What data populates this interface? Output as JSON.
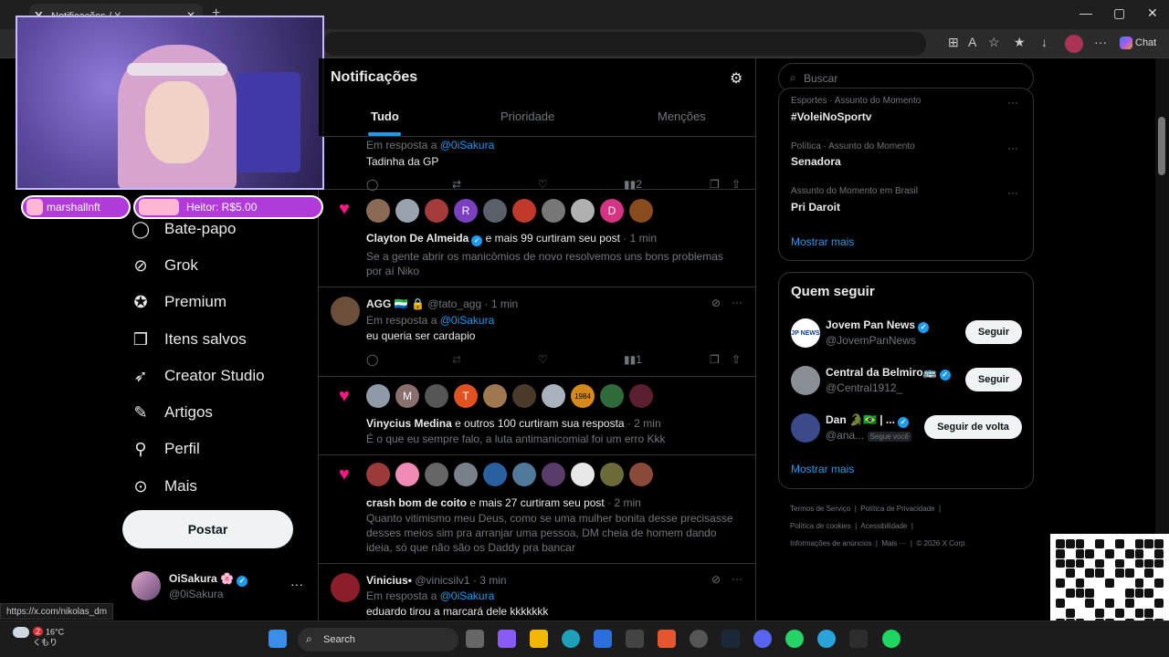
{
  "browser": {
    "tab_title": "Notificações / X",
    "tab_logo": "X",
    "close_glyph": "✕",
    "new_tab_glyph": "+",
    "window_controls": [
      "—",
      "▢",
      "✕"
    ],
    "chat_label": "Chat",
    "status_url": "https://x.com/nikolas_dm"
  },
  "nav": {
    "items": [
      {
        "label": "Bate-papo",
        "icon": "chat-icon"
      },
      {
        "label": "Grok",
        "icon": "grok-icon"
      },
      {
        "label": "Premium",
        "icon": "premium-icon"
      },
      {
        "label": "Itens salvos",
        "icon": "bookmark-icon"
      },
      {
        "label": "Creator Studio",
        "icon": "rocket-icon"
      },
      {
        "label": "Artigos",
        "icon": "article-icon"
      },
      {
        "label": "Perfil",
        "icon": "person-icon"
      },
      {
        "label": "Mais",
        "icon": "more-circle-icon"
      }
    ],
    "post_label": "Postar",
    "profile": {
      "name": "OiSakura 🌸",
      "handle": "@0iSakura",
      "more": "···"
    }
  },
  "main": {
    "title": "Notificações",
    "tabs": [
      {
        "label": "Tudo",
        "active": true
      },
      {
        "label": "Prioridade",
        "active": false
      },
      {
        "label": "Menções",
        "active": false
      }
    ],
    "n1": {
      "reply_to_prefix": "Em resposta a",
      "reply_to_handle": "@0iSakura",
      "text": "Tadinha da GP",
      "views": "2"
    },
    "n2": {
      "avatars": [
        "",
        "",
        "",
        "R",
        "",
        "",
        "",
        "",
        "D",
        ""
      ],
      "name": "Clayton De Almeida",
      "action": "e mais 99 curtiram seu post",
      "time": "· 1 min",
      "text_line1": "Se a gente abrir os manicômios de novo resolvemos uns bons problemas",
      "text_line2": "por aí Niko"
    },
    "n3": {
      "name": "AGG 🇸🇱 🔒",
      "handle": "@tato_agg",
      "time": "· 1 min",
      "reply_to_prefix": "Em resposta a",
      "reply_to_handle": "@0iSakura",
      "text": "eu queria ser cardapio",
      "views": "1"
    },
    "n4": {
      "avatars": [
        "",
        "M",
        "",
        "T",
        "",
        "",
        "",
        "1984",
        "",
        ""
      ],
      "name": "Vinycius Medina",
      "action": "e outros 100 curtiram sua resposta",
      "time": "· 2 min",
      "text": "É o que eu sempre falo, a luta antimanicomial foi um erro Kkk"
    },
    "n5": {
      "name": "crash bom de coito",
      "action": "e mais 27 curtiram seu post",
      "time": "· 2 min",
      "text_line1": "Quanto vitimismo meu Deus, como se uma mulher bonita desse precisasse",
      "text_line2": "desses meios sim pra arranjar uma pessoa, DM cheia de homem dando",
      "text_line3": "ideia, só que não são os Daddy pra bancar"
    },
    "n6": {
      "name": "Vinicius•",
      "handle": "@vinicsilv1",
      "time": "· 3 min",
      "reply_to_prefix": "Em resposta a",
      "reply_to_handle": "@0iSakura",
      "text": "eduardo tirou a marcará dele kkkkkkk"
    }
  },
  "right": {
    "search_placeholder": "Buscar",
    "trends": [
      {
        "category": "Esportes · Assunto do Momento",
        "name": "#VoleiNoSportv"
      },
      {
        "category": "Política · Assunto do Momento",
        "name": "Senadora"
      },
      {
        "category": "Assunto do Momento em Brasil",
        "name": "Pri Daroit"
      }
    ],
    "show_more": "Mostrar mais",
    "who_to_follow": {
      "title": "Quem seguir",
      "accounts": [
        {
          "name": "Jovem Pan News",
          "handle": "@JovemPanNews",
          "button": "Seguir",
          "avatar_text": "JP NEWS"
        },
        {
          "name": "Central da Belmiro🚌",
          "handle": "@Central1912_",
          "button": "Seguir",
          "avatar_text": ""
        },
        {
          "name": "Dan 🐊🇧🇷 | ...",
          "handle": "@ana...",
          "badge": "Segue você",
          "button": "Seguir de volta",
          "avatar_text": ""
        }
      ],
      "show_more": "Mostrar mais"
    },
    "footer": {
      "line1": [
        "Termos de Serviço",
        "Política de Privacidade"
      ],
      "line2": [
        "Política de cookies",
        "Acessibilidade"
      ],
      "line3": [
        "Informações de anúncios",
        "Mais ···",
        "© 2026 X Corp."
      ]
    }
  },
  "overlay": {
    "donation1": "marshallnft",
    "donation2": "Heitor: R$5.00"
  },
  "taskbar": {
    "temperature": "16°C",
    "weather_text": "くもり",
    "weather_badge": "2",
    "search_label": "Search"
  },
  "colors": {
    "accent": "#1d9bf0",
    "like": "#f91880",
    "background": "#000000"
  }
}
